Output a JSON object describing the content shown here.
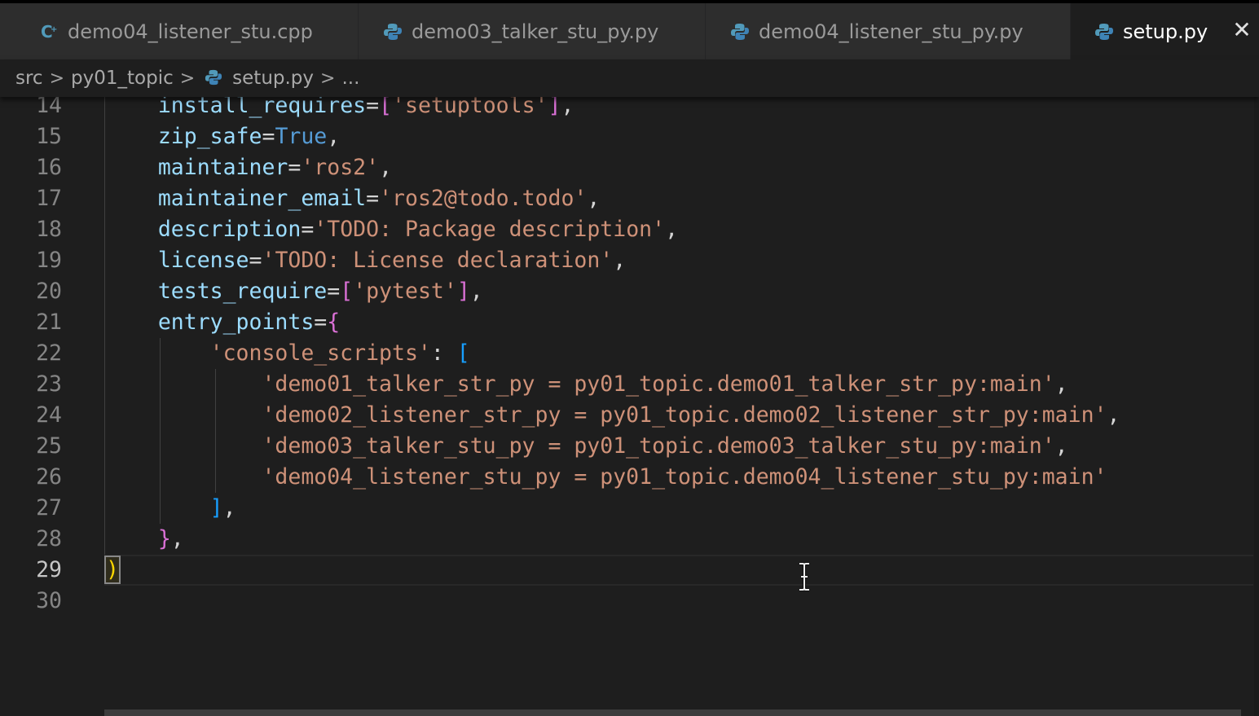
{
  "tabs": [
    {
      "label": "demo04_listener_stu.cpp",
      "icon": "cpp-file-icon",
      "active": false
    },
    {
      "label": "demo03_talker_stu_py.py",
      "icon": "python-file-icon",
      "active": false
    },
    {
      "label": "demo04_listener_stu_py.py",
      "icon": "python-file-icon",
      "active": false
    },
    {
      "label": "setup.py",
      "icon": "python-file-icon",
      "active": true
    }
  ],
  "breadcrumb": {
    "segments": [
      "src",
      "py01_topic",
      "setup.py",
      "..."
    ]
  },
  "editor": {
    "current_line": 29,
    "line_numbers": [
      "14",
      "15",
      "16",
      "17",
      "18",
      "19",
      "20",
      "21",
      "22",
      "23",
      "24",
      "25",
      "26",
      "27",
      "28",
      "29",
      "30"
    ],
    "lines": [
      {
        "indent": "    ",
        "key": "install_requires",
        "eq": "=",
        "open": "[",
        "str": "'setuptools'",
        "close": "]",
        "tail": ","
      },
      {
        "indent": "    ",
        "key": "zip_safe",
        "eq": "=",
        "kw": "True",
        "tail": ","
      },
      {
        "indent": "    ",
        "key": "maintainer",
        "eq": "=",
        "str": "'ros2'",
        "tail": ","
      },
      {
        "indent": "    ",
        "key": "maintainer_email",
        "eq": "=",
        "str": "'ros2@todo.todo'",
        "tail": ","
      },
      {
        "indent": "    ",
        "key": "description",
        "eq": "=",
        "str": "'TODO: Package description'",
        "tail": ","
      },
      {
        "indent": "    ",
        "key": "license",
        "eq": "=",
        "str": "'TODO: License declaration'",
        "tail": ","
      },
      {
        "indent": "    ",
        "key": "tests_require",
        "eq": "=",
        "open": "[",
        "str": "'pytest'",
        "close": "]",
        "tail": ","
      },
      {
        "indent": "    ",
        "key": "entry_points",
        "eq": "=",
        "open": "{"
      },
      {
        "indent": "        ",
        "str": "'console_scripts'",
        "colon": ": ",
        "open": "["
      },
      {
        "indent": "            ",
        "str": "'demo01_talker_str_py = py01_topic.demo01_talker_str_py:main'",
        "tail": ","
      },
      {
        "indent": "            ",
        "str": "'demo02_listener_str_py = py01_topic.demo02_listener_str_py:main'",
        "tail": ","
      },
      {
        "indent": "            ",
        "str": "'demo03_talker_stu_py = py01_topic.demo03_talker_stu_py:main'",
        "tail": ","
      },
      {
        "indent": "            ",
        "str": "'demo04_listener_stu_py = py01_topic.demo04_listener_stu_py:main'"
      },
      {
        "indent": "        ",
        "close": "]",
        "tail": ","
      },
      {
        "indent": "    ",
        "close": "}",
        "tail": ","
      },
      {
        "indent": "",
        "close": ")"
      },
      {
        "indent": ""
      }
    ]
  },
  "colors": {
    "background": "#1e1e1e",
    "tab_inactive": "#2d2d2d",
    "property": "#9cdcfe",
    "string": "#ce9178",
    "keyword": "#569cd6"
  }
}
